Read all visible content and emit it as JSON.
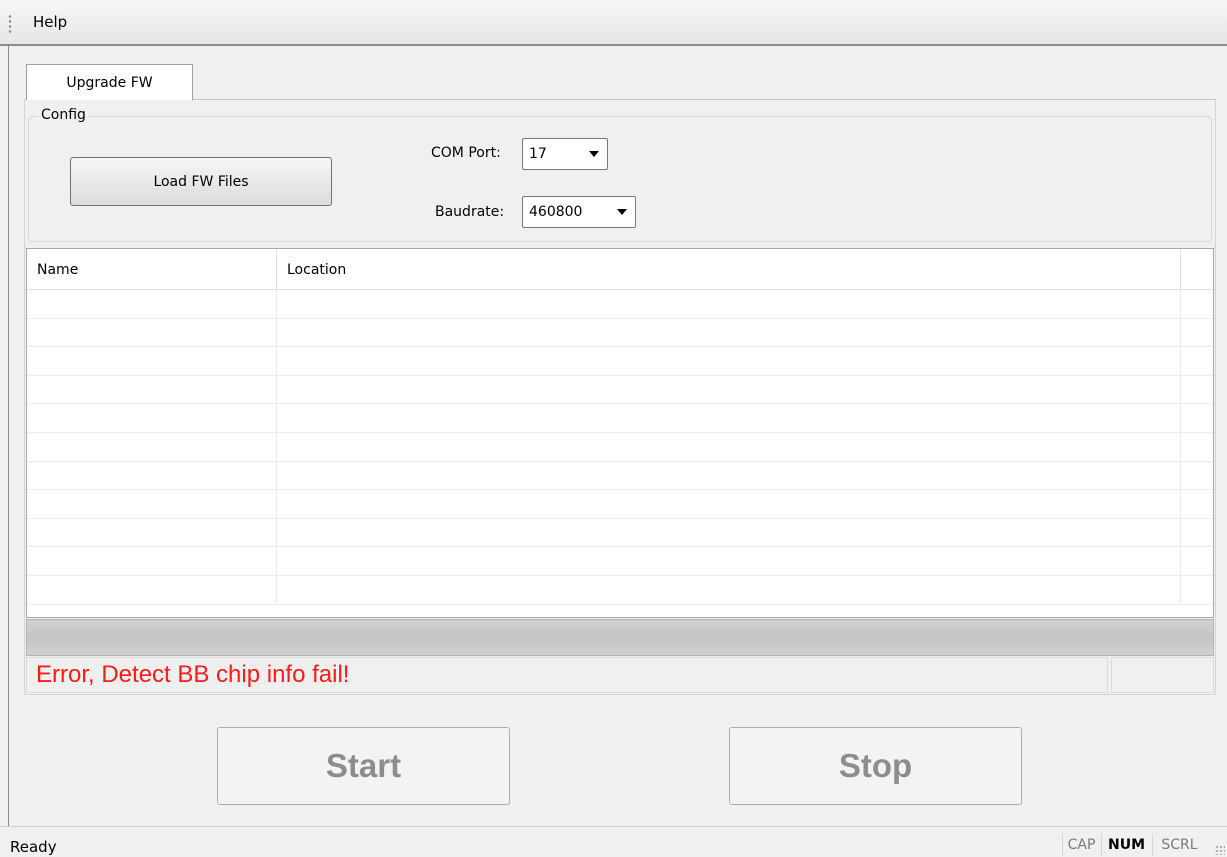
{
  "menu": {
    "items": [
      {
        "label": "Help"
      }
    ]
  },
  "tabs": [
    {
      "label": "Upgrade FW",
      "active": true
    }
  ],
  "config": {
    "group_label": "Config",
    "load_button": "Load FW Files",
    "com_port": {
      "label": "COM Port:",
      "value": "17"
    },
    "baudrate": {
      "label": "Baudrate:",
      "value": "460800"
    }
  },
  "file_table": {
    "columns": [
      "Name",
      "Location"
    ],
    "rows": [
      [
        "",
        ""
      ],
      [
        "",
        ""
      ],
      [
        "",
        ""
      ],
      [
        "",
        ""
      ],
      [
        "",
        ""
      ],
      [
        "",
        ""
      ],
      [
        "",
        ""
      ],
      [
        "",
        ""
      ],
      [
        "",
        ""
      ],
      [
        "",
        ""
      ],
      [
        "",
        ""
      ]
    ]
  },
  "progress": {
    "percent": 0
  },
  "message": {
    "text": "Error, Detect BB chip info fail!",
    "color": "#ff1a1a"
  },
  "actions": {
    "start_label": "Start",
    "stop_label": "Stop"
  },
  "status_bar": {
    "text": "Ready",
    "indicators": [
      {
        "label": "CAP",
        "active": false
      },
      {
        "label": "NUM",
        "active": true
      },
      {
        "label": "SCRL",
        "active": false
      }
    ]
  }
}
